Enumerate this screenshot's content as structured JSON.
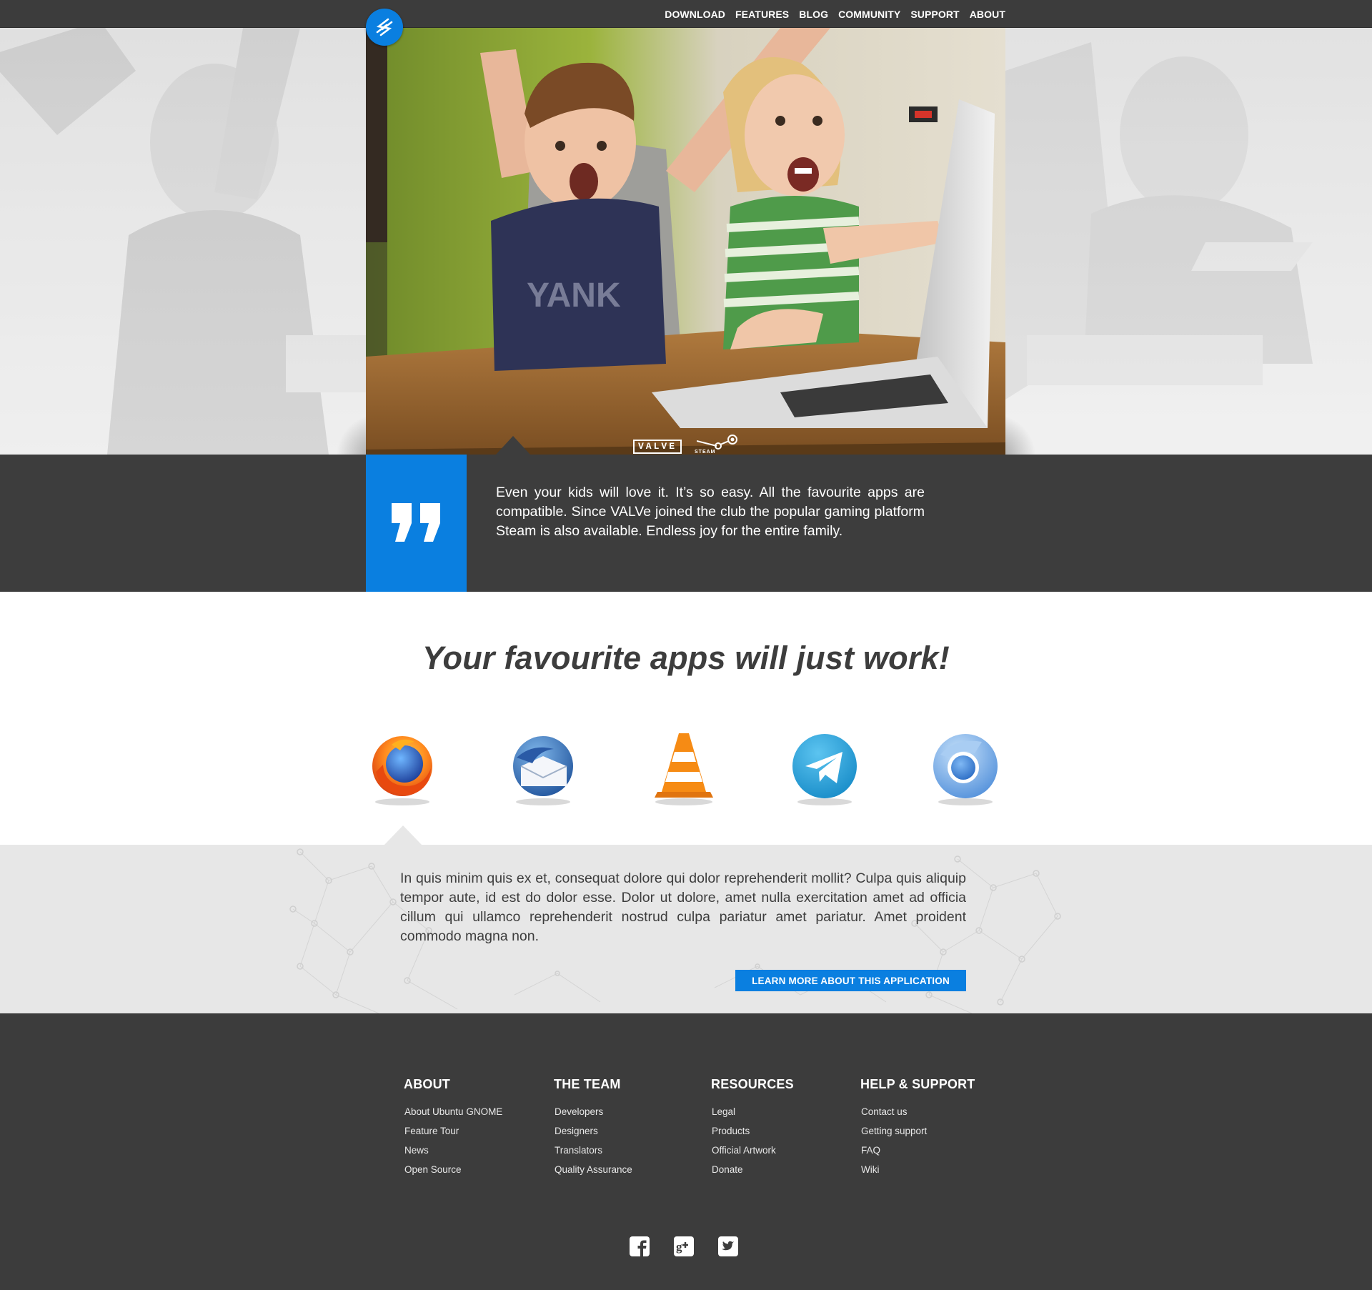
{
  "nav": {
    "links": [
      "DOWNLOAD",
      "FEATURES",
      "BLOG",
      "COMMUNITY",
      "SUPPORT",
      "ABOUT"
    ]
  },
  "hero": {
    "brand_valve": "VALVE",
    "brand_steam": "STEAM",
    "slides_total": 5,
    "slide_active": 1
  },
  "quote": {
    "text": "Even your kids will love it. It’s so easy. All the favourite apps are compatible. Since VALVe joined the club the popular gaming platform Steam is also available. Endless joy for the entire family."
  },
  "apps": {
    "title": "Your favourite apps will just work!",
    "icons": [
      "firefox-icon",
      "thunderbird-icon",
      "vlc-icon",
      "telegram-icon",
      "chromium-icon"
    ]
  },
  "description": {
    "text": "In quis minim quis ex et, consequat dolore qui dolor reprehenderit mollit? Culpa quis aliquip tempor aute, id est do dolor esse. Dolor ut dolore, amet nulla exercitation amet ad officia cillum qui ullamco reprehenderit nostrud culpa pariatur amet pariatur. Amet proident commodo magna non.",
    "button": "LEARN MORE ABOUT THIS APPLICATION"
  },
  "footer": {
    "columns": [
      {
        "heading": "ABOUT",
        "links": [
          "About Ubuntu GNOME",
          "Feature Tour",
          "News",
          "Open Source"
        ]
      },
      {
        "heading": "THE TEAM",
        "links": [
          "Developers",
          "Designers",
          "Translators",
          "Quality Assurance"
        ]
      },
      {
        "heading": "RESOURCES",
        "links": [
          "Legal",
          "Products",
          "Official Artwork",
          "Donate"
        ]
      },
      {
        "heading": "HELP & SUPPORT",
        "links": [
          "Contact us",
          "Getting support",
          "FAQ",
          "Wiki"
        ]
      }
    ],
    "social": [
      "facebook-icon",
      "google-plus-icon",
      "twitter-icon"
    ]
  },
  "colors": {
    "accent": "#0a7fe0",
    "dark": "#3d3d3d",
    "light_band": "#e7e7e7"
  }
}
